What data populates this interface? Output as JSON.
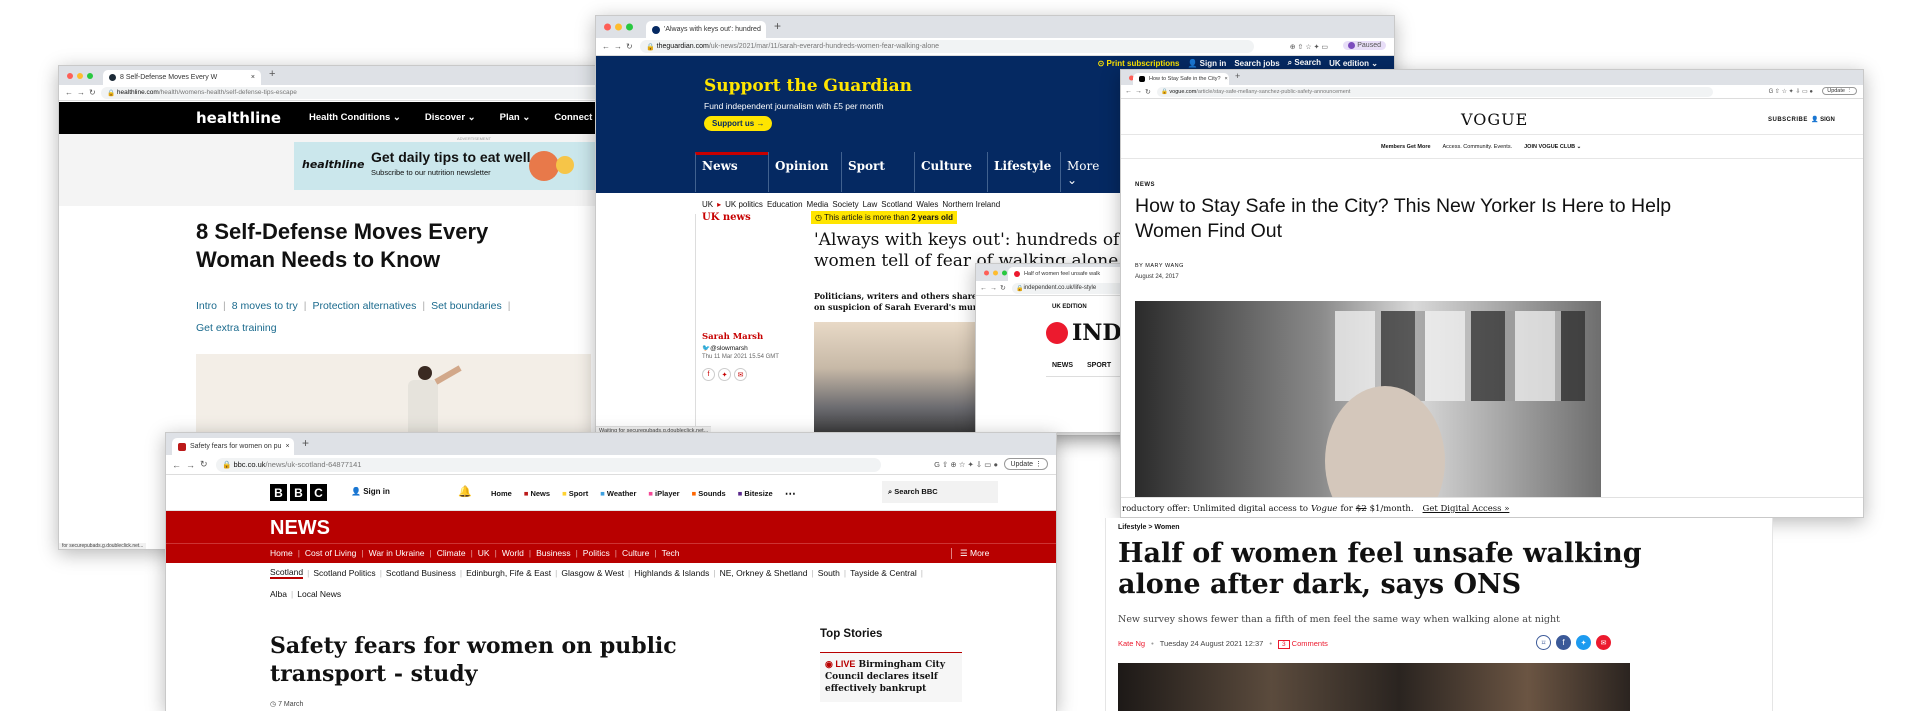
{
  "healthline": {
    "tab": "8 Self-Defense Moves Every W",
    "url_domain": "healthline.com",
    "url_path": "/health/womens-health/self-defense-tips-escape",
    "logo": "healthline",
    "nav": [
      "Health Conditions",
      "Discover",
      "Plan",
      "Connect"
    ],
    "ad_label": "ADVERTISEMENT",
    "ad_logo": "healthline",
    "ad_title": "Get daily tips to eat well",
    "ad_sub": "Subscribe to our nutrition newsletter",
    "title": "8 Self-Defense Moves Every Woman Needs to Know",
    "toc": [
      "Intro",
      "8 moves to try",
      "Protection alternatives",
      "Set boundaries"
    ],
    "toc2": "Get extra training",
    "status": "for securepubads.g.doubleclick.net..."
  },
  "guardian": {
    "tab": "'Always with keys out': hundred",
    "url_domain": "theguardian.com",
    "url_path": "/uk-news/2021/mar/11/sarah-everard-hundreds-women-fear-walking-alone",
    "paused": "Paused",
    "top": [
      "Print subscriptions",
      "Sign in",
      "Search jobs",
      "Search",
      "UK edition"
    ],
    "support_title": "Support the Guardian",
    "support_sub": "Fund independent journalism with £5 per month",
    "support_btn": "Support us",
    "nav": [
      "News",
      "Opinion",
      "Sport",
      "Culture",
      "Lifestyle",
      "More"
    ],
    "subnav": [
      "UK",
      "UK politics",
      "Education",
      "Media",
      "Society",
      "Law",
      "Scotland",
      "Wales",
      "Northern Ireland"
    ],
    "section": "UK news",
    "age_a": "This article is more than",
    "age_b": "2 years old",
    "headline_a": "'Always with keys out': hundreds of",
    "headline_b": "women tell of fear of walking alone",
    "standfirst_a": "Politicians, writers and others share stories",
    "standfirst_b": "on suspicion of Sarah Everard's murder",
    "author": "Sarah Marsh",
    "twitter": "@slowmarsh",
    "date": "Thu 11 Mar 2021 15.54 GMT",
    "status": "Waiting for securepubads.g.doubleclick.net..."
  },
  "independent": {
    "tab": "Half of women feel unsafe walk",
    "url": "independent.co.uk/life-style",
    "edition": "UK EDITION",
    "logo": "INDE",
    "nav": [
      "NEWS",
      "SPORT"
    ],
    "breadcrumb": "Lifestyle > Women",
    "headline_a": "Half of women feel unsafe walking",
    "headline_b": "alone after dark, says ONS",
    "standfirst": "New survey shows fewer than a fifth of men feel the same way when walking alone at night",
    "author": "Kate Ng",
    "date": "Tuesday 24 August 2021 12:37",
    "comments_count": "3",
    "comments": "Comments"
  },
  "vogue": {
    "tab": "How to Stay Safe in the City?",
    "url_domain": "vogue.com",
    "url_path": "/article/stay-safe-mellany-sanchez-public-safety-announcement",
    "update": "Update",
    "logo": "VOGUE",
    "subscribe": "SUBSCRIBE",
    "signin": "SIGN",
    "members": "Members Get More",
    "access": "Access. Community. Events.",
    "join": "JOIN VOGUE CLUB",
    "section": "NEWS",
    "headline_a": "How to Stay Safe in the City? This New Yorker Is Here to Help",
    "headline_b": "Women Find Out",
    "byline": "BY MARY WANG",
    "date": "August 24, 2017",
    "offer_a": "roductory offer: Unlimited digital access to",
    "offer_b": "Vogue",
    "offer_c": "for",
    "offer_strike": "$2",
    "offer_d": "$1/month.",
    "offer_link": "Get Digital Access »"
  },
  "bbc": {
    "tab": "Safety fears for women on pu",
    "url_domain": "bbc.co.uk",
    "url_path": "/news/uk-scotland-64877141",
    "update": "Update",
    "logo": [
      "B",
      "B",
      "C"
    ],
    "signin": "Sign in",
    "nav": [
      "Home",
      "News",
      "Sport",
      "Weather",
      "iPlayer",
      "Sounds",
      "Bitesize"
    ],
    "search": "Search BBC",
    "news_title": "NEWS",
    "news_nav": [
      "Home",
      "Cost of Living",
      "War in Ukraine",
      "Climate",
      "UK",
      "World",
      "Business",
      "Politics",
      "Culture",
      "Tech"
    ],
    "more": "More",
    "subnav": [
      "Scotland",
      "Scotland Politics",
      "Scotland Business",
      "Edinburgh, Fife & East",
      "Glasgow & West",
      "Highlands & Islands",
      "NE, Orkney & Shetland",
      "South",
      "Tayside & Central"
    ],
    "subnav2": [
      "Alba",
      "Local News"
    ],
    "headline_a": "Safety fears for women on public",
    "headline_b": "transport - study",
    "date": "7 March",
    "top_stories": "Top Stories",
    "live": "LIVE",
    "story_a": "Birmingham City",
    "story_b": "Council declares itself",
    "story_c": "effectively bankrupt"
  }
}
